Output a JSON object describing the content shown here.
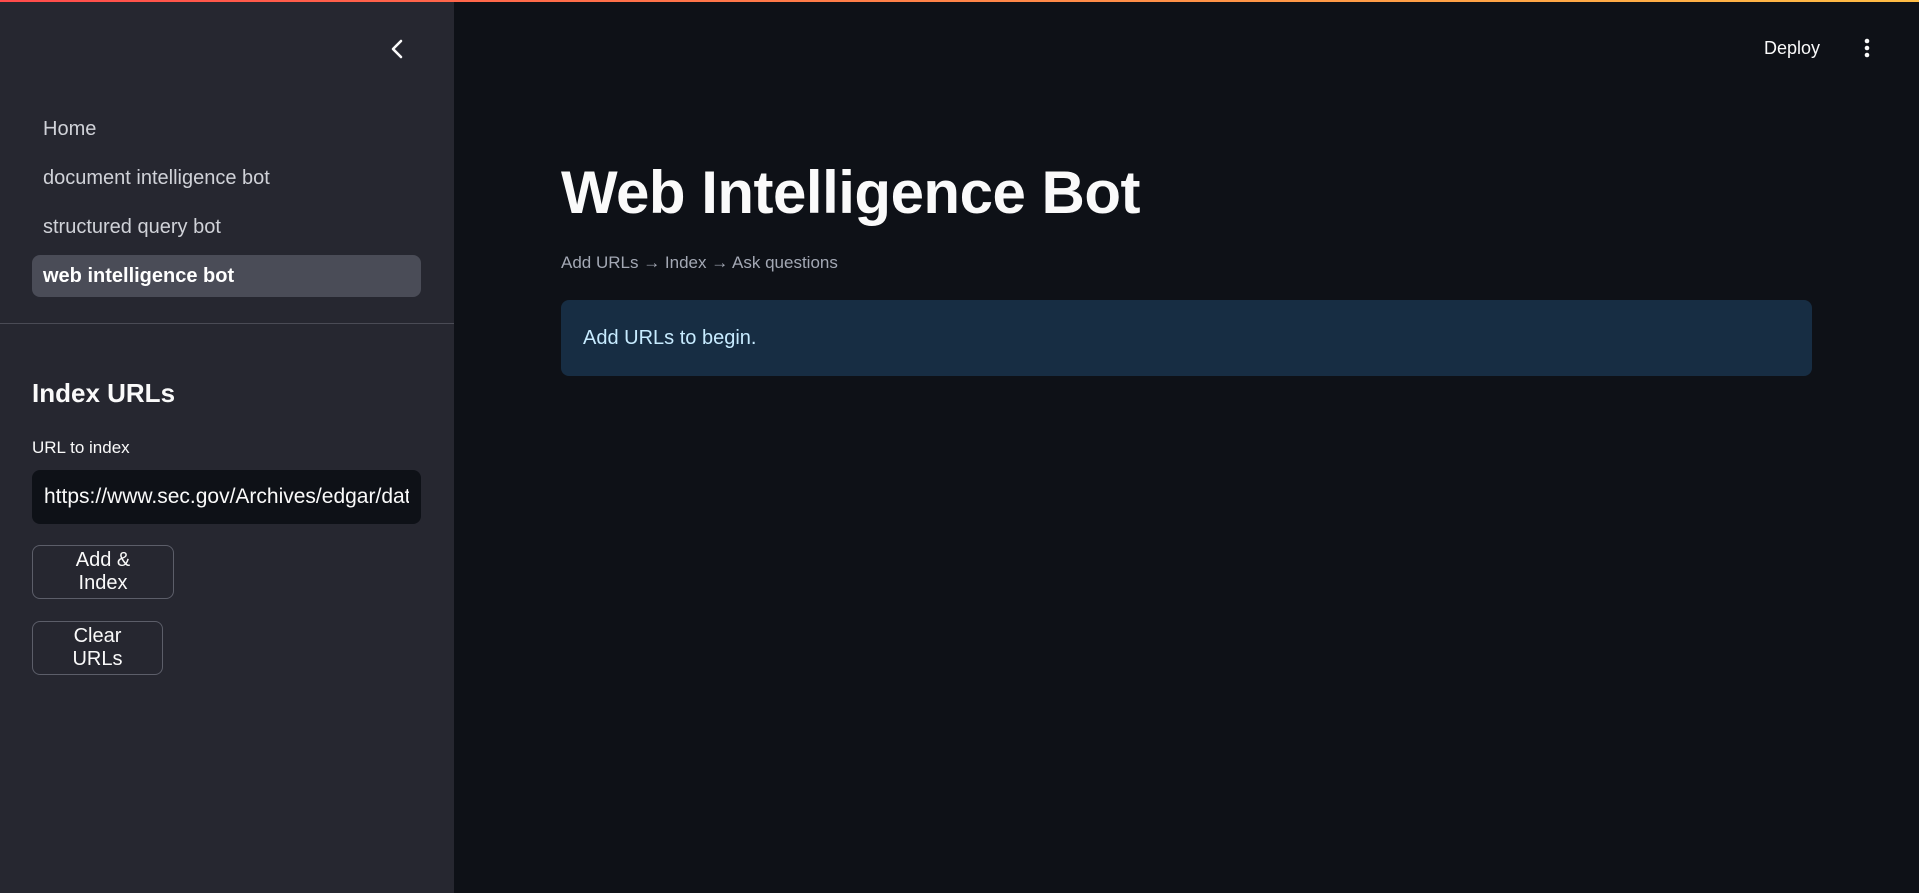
{
  "sidebar": {
    "nav_items": [
      {
        "label": "Home",
        "active": false
      },
      {
        "label": "document intelligence bot",
        "active": false
      },
      {
        "label": "structured query bot",
        "active": false
      },
      {
        "label": "web intelligence bot",
        "active": true
      }
    ],
    "section_title": "Index URLs",
    "url_field": {
      "label": "URL to index",
      "value": "https://www.sec.gov/Archives/edgar/data/"
    },
    "add_button_label": "Add & Index",
    "clear_button_label": "Clear URLs"
  },
  "header": {
    "deploy_label": "Deploy",
    "menu_icon": "more-vertical-icon"
  },
  "main": {
    "title": "Web Intelligence Bot",
    "caption": "Add URLs → Index → Ask questions",
    "info_message": "Add URLs to begin."
  },
  "colors": {
    "background": "#0e1117",
    "sidebar": "#262730",
    "active_nav": "#4a4c57",
    "info_bg": "#172d43",
    "info_text": "#c7ebff",
    "accent_gradient_start": "#ff4b4b",
    "accent_gradient_end": "#ffbd45"
  }
}
